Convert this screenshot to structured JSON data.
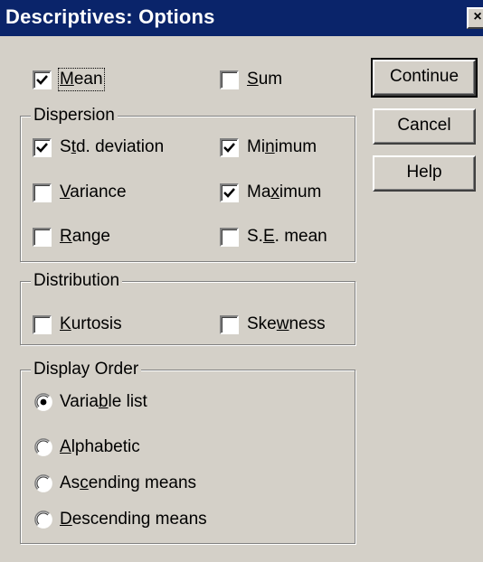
{
  "window": {
    "title": "Descriptives: Options"
  },
  "top": {
    "mean": {
      "label": "Mean",
      "checked": true
    },
    "sum": {
      "label": "Sum",
      "checked": false
    }
  },
  "dispersion": {
    "title": "Dispersion",
    "std_deviation": {
      "label": "Std. deviation",
      "checked": true
    },
    "variance": {
      "label": "Variance",
      "checked": false
    },
    "range": {
      "label": "Range",
      "checked": false
    },
    "minimum": {
      "label": "Minimum",
      "checked": true
    },
    "maximum": {
      "label": "Maximum",
      "checked": true
    },
    "se_mean": {
      "label": "S.E. mean",
      "checked": false
    }
  },
  "distribution": {
    "title": "Distribution",
    "kurtosis": {
      "label": "Kurtosis",
      "checked": false
    },
    "skewness": {
      "label": "Skewness",
      "checked": false
    }
  },
  "display_order": {
    "title": "Display Order",
    "selected": "Variable list",
    "options": [
      "Variable list",
      "Alphabetic",
      "Ascending means",
      "Descending means"
    ]
  },
  "buttons": {
    "continue": "Continue",
    "cancel": "Cancel",
    "help": "Help"
  },
  "colors": {
    "titlebar": "#0a246a",
    "face": "#d4d0c8"
  }
}
